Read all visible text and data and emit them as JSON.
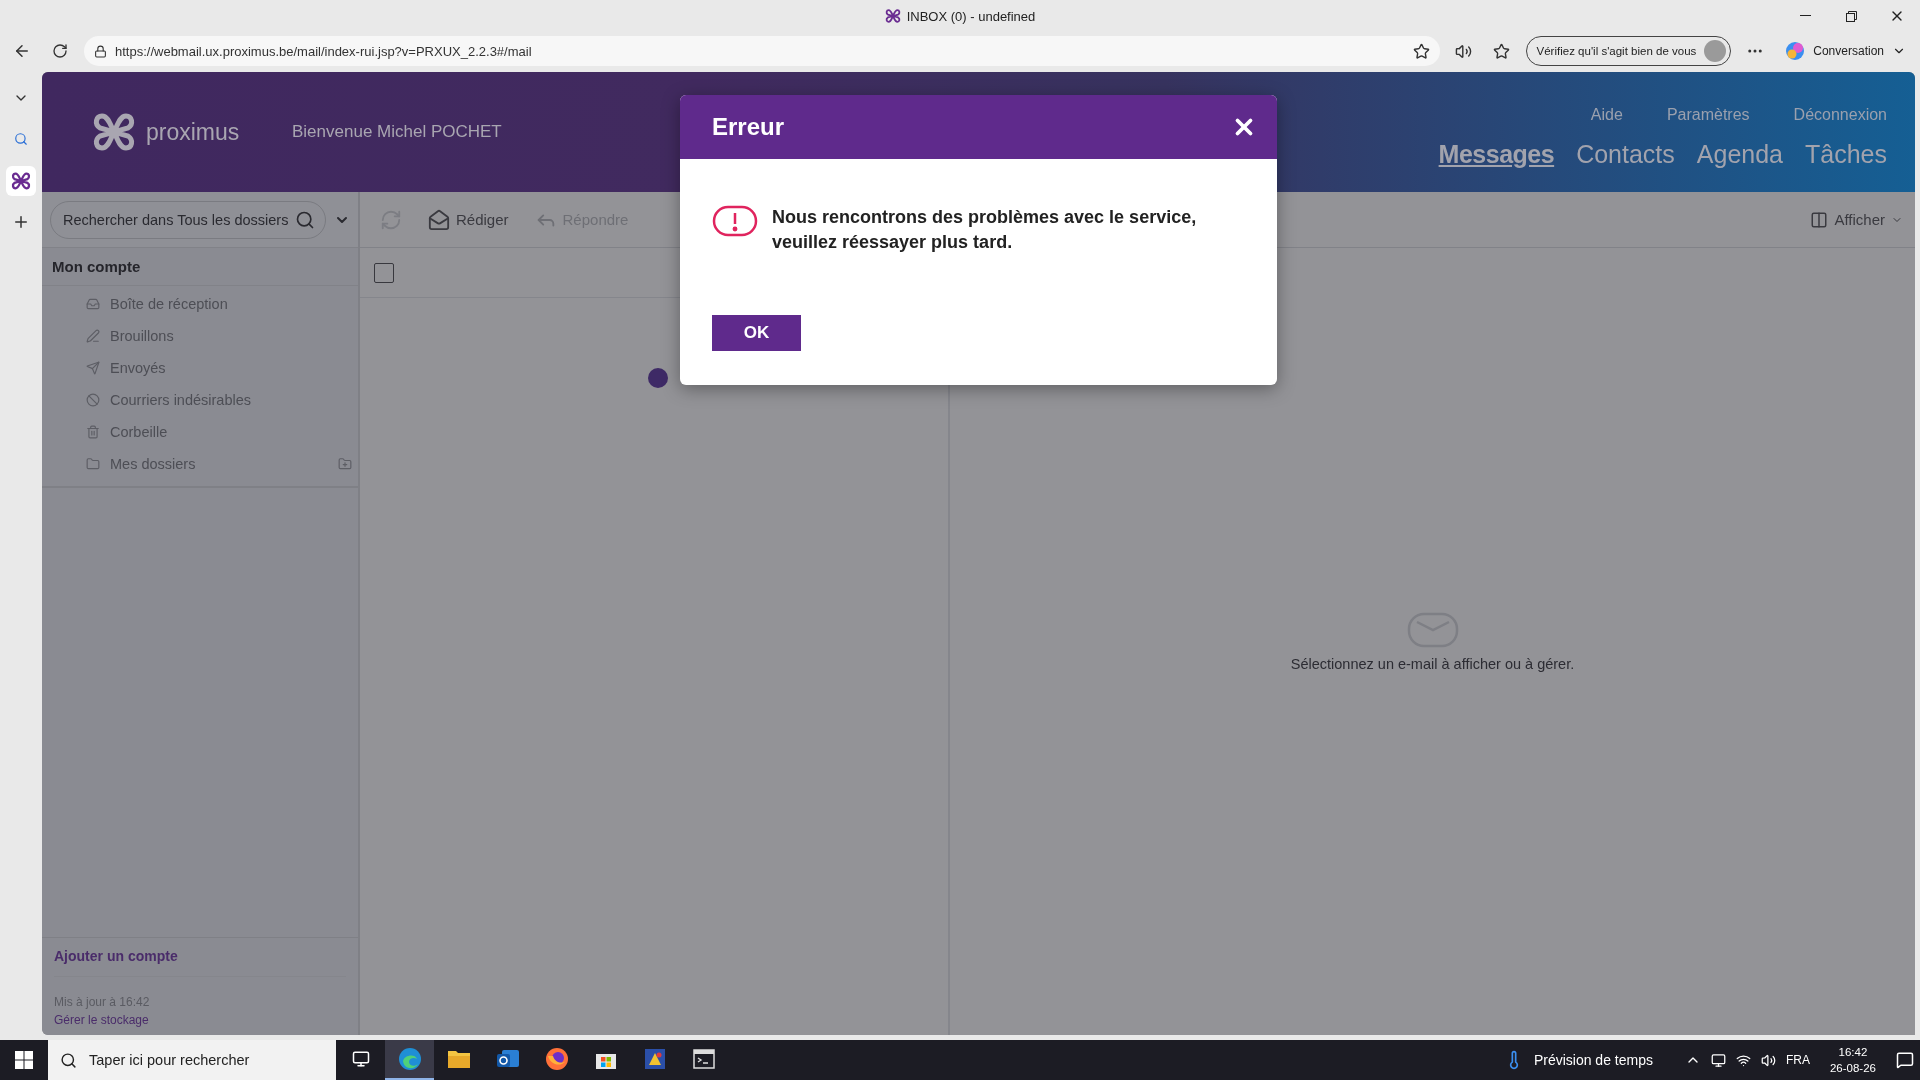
{
  "browser": {
    "title": "INBOX (0) - undefined",
    "url": "https://webmail.ux.proximus.be/mail/index-rui.jsp?v=PRXUX_2.2.3#/mail",
    "profile_prompt": "Vérifiez qu'il s'agit bien de vous",
    "copilot": "Conversation"
  },
  "header": {
    "logo": "proximus",
    "welcome": "Bienvenue Michel POCHET",
    "top_links": [
      "Aide",
      "Paramètres",
      "Déconnexion"
    ],
    "nav": [
      {
        "label": "Messages",
        "selected": true
      },
      {
        "label": "Contacts",
        "selected": false
      },
      {
        "label": "Agenda",
        "selected": false
      },
      {
        "label": "Tâches",
        "selected": false
      }
    ]
  },
  "search": {
    "placeholder": "Rechercher dans Tous les dossiers"
  },
  "toolbar": {
    "buttons": [
      {
        "kind": "compose",
        "label": "Rédiger",
        "disabled": false
      },
      {
        "kind": "reply",
        "label": "Répondre",
        "disabled": true
      }
    ],
    "view": "Afficher"
  },
  "sidebar": {
    "heading": "Mon compte",
    "folders": [
      {
        "kind": "inbox",
        "label": "Boîte de réception"
      },
      {
        "kind": "drafts",
        "label": "Brouillons"
      },
      {
        "kind": "sent",
        "label": "Envoyés"
      },
      {
        "kind": "junk",
        "label": "Courriers indésirables"
      },
      {
        "kind": "trash",
        "label": "Corbeille"
      },
      {
        "kind": "folders",
        "label": "Mes dossiers"
      }
    ],
    "add_account": "Ajouter un compte",
    "updated": "Mis à jour à 16:42",
    "storage": "Gérer le stockage"
  },
  "message_list": {
    "select_all": {
      "checked": false
    }
  },
  "reading_pane": {
    "empty_text": "Sélectionnez un e-mail à afficher ou à gérer."
  },
  "dialog": {
    "title": "Erreur",
    "message": "Nous rencontrons des problèmes avec le service, veuillez réessayer plus tard.",
    "button": "OK"
  },
  "taskbar": {
    "search_placeholder": "Taper ici pour rechercher",
    "apps": [
      {
        "kind": "edge",
        "selected": true
      },
      {
        "kind": "explorer",
        "selected": false
      },
      {
        "kind": "mail",
        "selected": false
      },
      {
        "kind": "firefox",
        "selected": false
      },
      {
        "kind": "store",
        "selected": false
      },
      {
        "kind": "paint",
        "selected": false
      },
      {
        "kind": "terminal",
        "selected": false
      }
    ],
    "weather": "Prévision de temps",
    "language": "FRA",
    "time": "16:42",
    "date": "26-08-26"
  }
}
